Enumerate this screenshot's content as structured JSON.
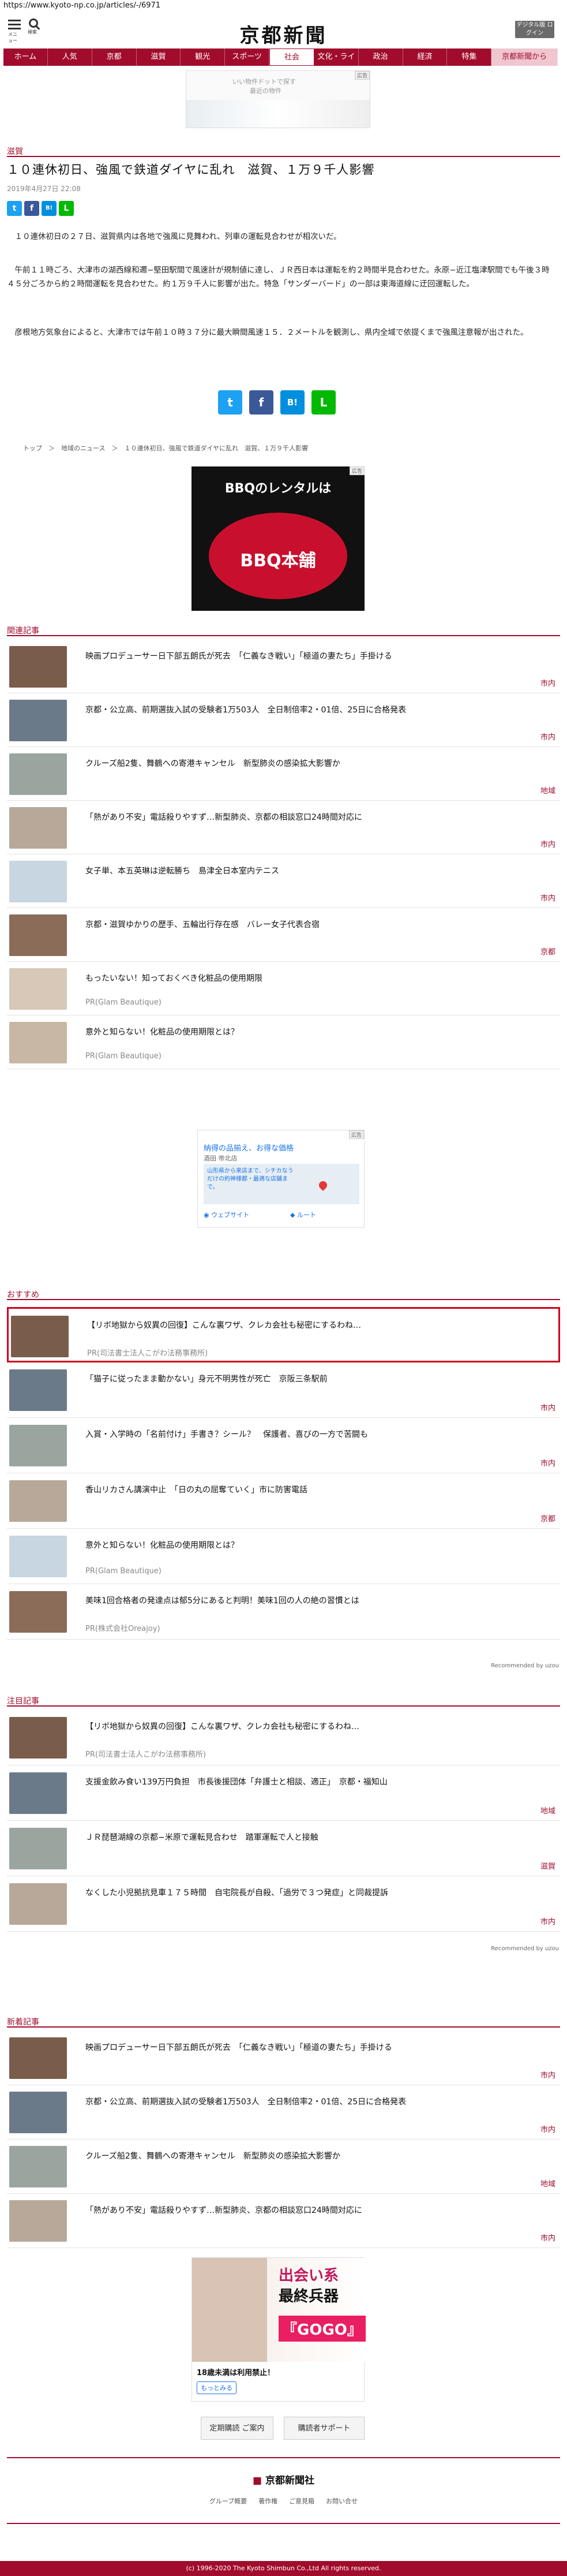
{
  "url": "https://www.kyoto-np.co.jp/articles/-/6971",
  "header": {
    "menu_label": "メニュー",
    "search_label": "検索",
    "logo": "京都新聞",
    "digital_btn": "デジタル版 ログイン"
  },
  "nav": [
    "ホーム",
    "人気",
    "京都",
    "滋賀",
    "観光",
    "スポーツ",
    "社会",
    "文化・ライフ",
    "政治",
    "経済",
    "特集",
    "京都新聞から"
  ],
  "nav_active": "社会",
  "top_ad": {
    "line1": "いい物件ドットで探す",
    "line2": "最近の物件"
  },
  "article": {
    "category": "滋賀",
    "title": "１０連休初日、強風で鉄道ダイヤに乱れ　滋賀、１万９千人影響",
    "date": "2019年4月27日 22:08",
    "share": [
      "t",
      "f",
      "B!",
      "L"
    ],
    "paragraphs": [
      "　１０連休初日の２７日、滋賀県内は各地で強風に見舞われ、列車の運転見合わせが相次いだ。",
      "　午前１１時ごろ、大津市の湖西線和邇−堅田駅間で風速計が規制値に達し、ＪＲ西日本は運転を約２時間半見合わせた。永原−近江塩津駅間でも午後３時４５分ごろから約２時間運転を見合わせた。約１万９千人に影響が出た。特急「サンダーバード」の一部は東海道線に迂回運転した。",
      "　彦根地方気象台によると、大津市では午前１０時３７分に最大瞬間風速１５．２メートルを観測し、県内全域で依提くまで強風注意報が出された。"
    ]
  },
  "breadcrumb": "トップ　＞　地域のニュース　＞　１０連休初日、強風で鉄道ダイヤに乱れ　滋賀、１万９千人影響",
  "ad_bbq": {
    "line1": "BBQのレンタルは",
    "brand": "BBQ本舗"
  },
  "related": {
    "label": "関連記事",
    "items": [
      {
        "title": "映画プロデューサー日下部五朗氏が死去　「仁義なき戦い」「極道の妻たち」手掛ける",
        "cat": "市内",
        "pr": ""
      },
      {
        "title": "京都・公立高、前期選抜入試の受験者1万503人　全日制倍率2・01倍、25日に合格発表",
        "cat": "市内",
        "pr": ""
      },
      {
        "title": "クルーズ船2隻、舞鶴への寄港キャンセル　新型肺炎の感染拡大影響か",
        "cat": "地域",
        "pr": ""
      },
      {
        "title": "「熱があり不安」電話殺りやすず…新型肺炎、京都の相談窓口24時間対応に",
        "cat": "市内",
        "pr": ""
      },
      {
        "title": "女子単、本五英琳は逆転勝ち　島津全日本室内テニス",
        "cat": "市内",
        "pr": ""
      },
      {
        "title": "京都・滋賀ゆかりの歴手、五輪出行存在感　バレー女子代表合宿",
        "cat": "京都",
        "pr": ""
      },
      {
        "title": "もったいない！知っておくべき化粧品の使用期限",
        "cat": "",
        "pr": "PR(Glam Beautique)"
      },
      {
        "title": "意外と知らない！化粧品の使用期限とは？",
        "cat": "",
        "pr": "PR(Glam Beautique)"
      }
    ]
  },
  "map_ad": {
    "title": "納得の品揃え、お得な価格",
    "sub": "酒田 帝北店",
    "desc": "山形県から来店まで、シチカなうだけの約神様都・最適な店舗まで。",
    "btn1": "ウェブサイト",
    "btn2": "ルート"
  },
  "recommend": {
    "label": "おすすめ",
    "items": [
      {
        "title": "【リボ地獄から奴異の回復】こんな裏ワザ、クレカ会社も秘密にするわね…",
        "cat": "",
        "pr": "PR(司法書士法人こがわ法務事務所)"
      },
      {
        "title": "「猫子に従ったまま動かない」身元不明男性が死亡　京阪三条駅前",
        "cat": "市内",
        "pr": ""
      },
      {
        "title": "入賞・入学時の「名前付け」手書き？シール？　保護者、喜びの一方で苦闘も",
        "cat": "市内",
        "pr": ""
      },
      {
        "title": "香山リカさん講演中止　「日の丸の屈奪ていく」市に防害電話",
        "cat": "京都",
        "pr": ""
      },
      {
        "title": "意外と知らない！化粧品の使用期限とは？",
        "cat": "",
        "pr": "PR(Glam Beautique)"
      },
      {
        "title": "美味1回合格者の発達点は郁5分にあると判明！美味1回の人の絶の習慣とは",
        "cat": "",
        "pr": "PR(株式会社Oreajoy)"
      }
    ],
    "credit": "Recommended by uzou"
  },
  "attention": {
    "label": "注目記事",
    "items": [
      {
        "title": "【リボ地獄から奴異の回復】こんな裏ワザ、クレカ会社も秘密にするわね…",
        "cat": "",
        "pr": "PR(司法書士法人こがわ法務事務所)"
      },
      {
        "title": "支援金飲み食い139万円負担　市長後援団体「弁護士と相談、適正」　京都・福知山",
        "cat": "地域",
        "pr": ""
      },
      {
        "title": "ＪＲ琵琶湖線の京都−米原で運転見合わせ　踏軍運転で人と接触",
        "cat": "滋賀",
        "pr": ""
      },
      {
        "title": "なくした小児拠抗見車１７５時間　自宅院長が自殺、「過労で３つ発症」と同裁提訴",
        "cat": "市内",
        "pr": ""
      }
    ],
    "credit": "Recommended by uzou"
  },
  "latest": {
    "label": "新着記事",
    "items": [
      {
        "title": "映画プロデューサー日下部五朗氏が死去　「仁義なき戦い」「極道の妻たち」手掛ける",
        "cat": "市内"
      },
      {
        "title": "京都・公立高、前期選抜入試の受験者1万503人　全日制倍率2・01倍、25日に合格発表",
        "cat": "市内"
      },
      {
        "title": "クルーズ船2隻、舞鶴への寄港キャンセル　新型肺炎の感染拡大影響か",
        "cat": "地域"
      },
      {
        "title": "「熱があり不安」電話殺りやすず…新型肺炎、京都の相談窓口24時間対応に",
        "cat": "市内"
      }
    ]
  },
  "bottom_ad": {
    "line1": "出会い系",
    "line2": "最終兵器",
    "brand": "『GOGO』",
    "note": "18歳未満は利用禁止！",
    "more": "もっとみる"
  },
  "footer": {
    "subscribe_btn": "定期購読  ご案内",
    "support_btn": "購読者サポート",
    "logo": "京都新聞社",
    "links": [
      "グループ概要",
      "著作権",
      "ご意見箱",
      "お問い合せ"
    ],
    "copyright": "(c) 1996-2020 The Kyoto Shimbun Co.,Ltd All rights reserved."
  },
  "colors": {
    "accent": "#a10c2c",
    "twitter": "#1da1f2",
    "facebook": "#3b5998",
    "hatena": "#008fde",
    "line": "#00b900"
  }
}
